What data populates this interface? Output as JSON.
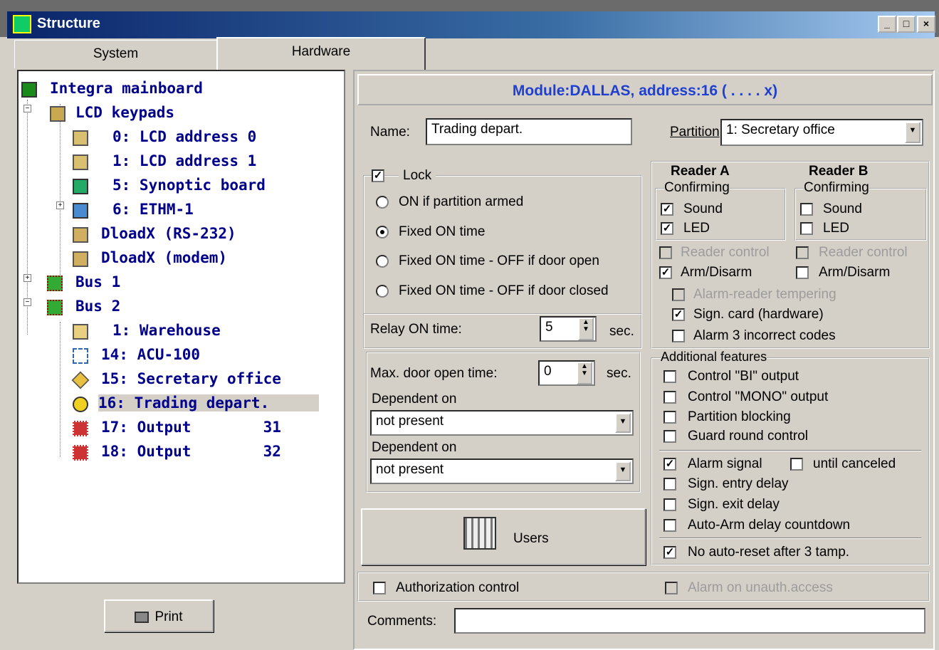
{
  "window": {
    "title": "Structure",
    "controls": [
      "_",
      "□",
      "×"
    ]
  },
  "tabs": [
    {
      "label": "System"
    },
    {
      "label": "Hardware"
    }
  ],
  "tree": {
    "items": [
      {
        "label": "Integra mainboard"
      },
      {
        "label": "LCD keypads"
      },
      {
        "label": "0: LCD address 0"
      },
      {
        "label": "1: LCD address 1"
      },
      {
        "label": "5: Synoptic board"
      },
      {
        "label": "6: ETHM-1"
      },
      {
        "label": "DloadX (RS-232)"
      },
      {
        "label": "DloadX (modem)"
      },
      {
        "label": "Bus 1"
      },
      {
        "label": "Bus 2"
      },
      {
        "label": "1: Warehouse"
      },
      {
        "label": "14: ACU-100"
      },
      {
        "label": "15: Secretary office"
      },
      {
        "label": "16: Trading depart."
      },
      {
        "label": "17: Output        31"
      },
      {
        "label": "18: Output        32"
      }
    ]
  },
  "print_label": "Print",
  "module_header": "Module:DALLAS, address:16 ( . . . . x)",
  "name": {
    "label": "Name:",
    "value": "Trading depart."
  },
  "partition": {
    "label": "Partition",
    "value": "1: Secretary office"
  },
  "lock": {
    "label": "Lock",
    "checked": true,
    "options": [
      "ON if partition armed",
      "Fixed ON time",
      "Fixed ON time - OFF if door open",
      "Fixed ON time - OFF if door closed"
    ],
    "selected": 1
  },
  "relay": {
    "label": "Relay ON time:",
    "value": "5",
    "unit": "sec."
  },
  "door": {
    "label": "Max. door open time:",
    "value": "0",
    "unit": "sec."
  },
  "dependent1": {
    "label": "Dependent on",
    "value": "not present"
  },
  "dependent2": {
    "label": "Dependent on",
    "value": "not present"
  },
  "users_label": "Users",
  "reader_a": {
    "title": "Reader A",
    "confirming": "Confirming",
    "sound": "Sound",
    "led": "LED",
    "reader_control": "Reader control",
    "arm_disarm": "Arm/Disarm"
  },
  "reader_b": {
    "title": "Reader B",
    "confirming": "Confirming",
    "sound": "Sound",
    "led": "LED",
    "reader_control": "Reader control",
    "arm_disarm": "Arm/Disarm"
  },
  "alarm_reader_tampering": "Alarm-reader tempering",
  "sign_card": "Sign. card (hardware)",
  "alarm3": "Alarm 3 incorrect codes",
  "additional": {
    "title": "Additional features",
    "control_bi": "Control \"BI\" output",
    "control_mono": "Control \"MONO\" output",
    "partition_blocking": "Partition blocking",
    "guard_round": "Guard round control",
    "alarm_signal": "Alarm signal",
    "until_canceled": "until canceled",
    "sign_entry": "Sign. entry delay",
    "sign_exit": "Sign. exit delay",
    "auto_arm": "Auto-Arm delay countdown",
    "no_auto_reset": "No auto-reset after 3 tamp."
  },
  "authorization": "Authorization control",
  "alarm_unauth": "Alarm on unauth.access",
  "comments": {
    "label": "Comments:",
    "value": ""
  }
}
